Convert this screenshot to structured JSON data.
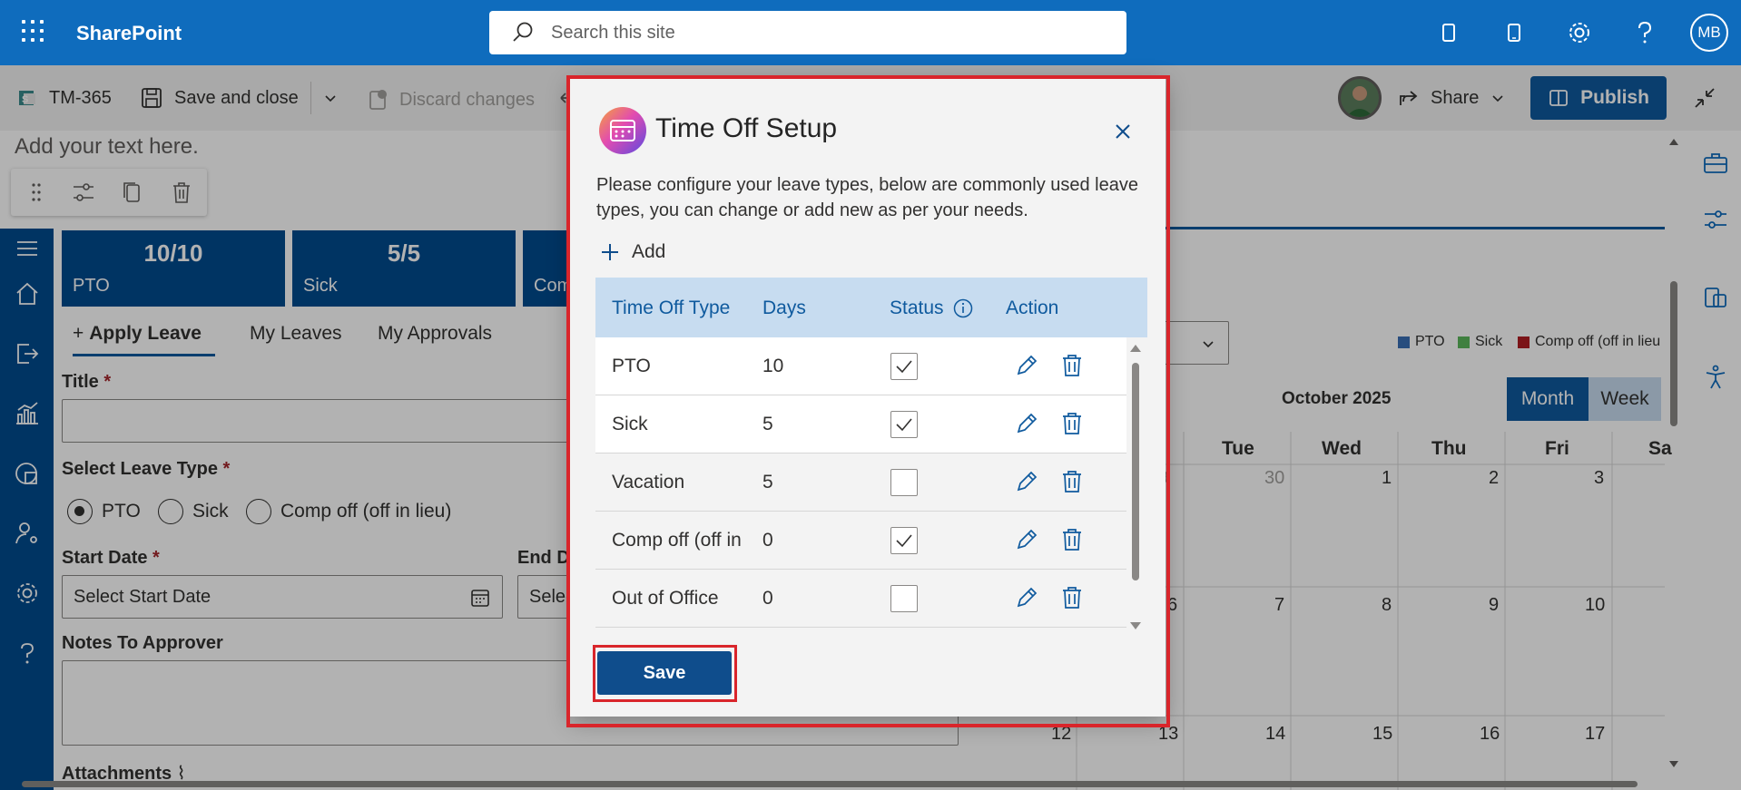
{
  "suite": {
    "app_name": "SharePoint",
    "search_placeholder": "Search this site",
    "user_initials": "MB"
  },
  "command_bar": {
    "page_name": "TM-365",
    "save_close": "Save and close",
    "discard": "Discard changes",
    "share": "Share",
    "publish": "Publish"
  },
  "canvas": {
    "add_text": "Add your text here."
  },
  "app": {
    "tiles": [
      {
        "value": "10/10",
        "label": "PTO"
      },
      {
        "value": "5/5",
        "label": "Sick"
      },
      {
        "value": "",
        "label": "Comp"
      }
    ],
    "tabs": {
      "apply": "Apply Leave",
      "my_leaves": "My Leaves",
      "approvals": "My Approvals"
    },
    "form": {
      "title_label": "Title",
      "required_mark": "*",
      "leave_type_label": "Select Leave Type",
      "leave_options": [
        "PTO",
        "Sick",
        "Comp off (off in lieu)"
      ],
      "start_date_label": "Start Date",
      "start_date_placeholder": "Select Start Date",
      "end_date_label": "End Da",
      "end_date_placeholder": "Selec",
      "notes_label": "Notes To Approver",
      "attachments_label": "Attachments"
    },
    "calendar": {
      "legend": [
        {
          "label": "PTO",
          "color": "#3a6fb5"
        },
        {
          "label": "Sick",
          "color": "#5cb85c"
        },
        {
          "label": "Comp off (off in lieu",
          "color": "#b01e23"
        }
      ],
      "month_title": "October 2025",
      "view_month": "Month",
      "view_week": "Week",
      "day_headers": [
        "Tue",
        "Wed",
        "Thu",
        "Fri",
        "Sa"
      ],
      "row1": [
        "9",
        "30",
        "1",
        "2",
        "3"
      ],
      "row2": [
        "6",
        "7",
        "8",
        "9",
        "10"
      ],
      "row3": [
        "12",
        "13",
        "14",
        "15",
        "16",
        "17"
      ]
    }
  },
  "dialog": {
    "title": "Time Off Setup",
    "description": "Please configure your leave types, below are commonly used leave types, you can change or add new as per your needs.",
    "add_label": "Add",
    "columns": {
      "type": "Time Off Type",
      "days": "Days",
      "status": "Status",
      "action": "Action"
    },
    "rows": [
      {
        "type": "PTO",
        "days": "10",
        "checked": true
      },
      {
        "type": "Sick",
        "days": "5",
        "checked": true
      },
      {
        "type": "Vacation",
        "days": "5",
        "checked": false
      },
      {
        "type": "Comp off (off in",
        "days": "0",
        "checked": true
      },
      {
        "type": "Out of Office",
        "days": "0",
        "checked": false
      }
    ],
    "save_label": "Save"
  }
}
